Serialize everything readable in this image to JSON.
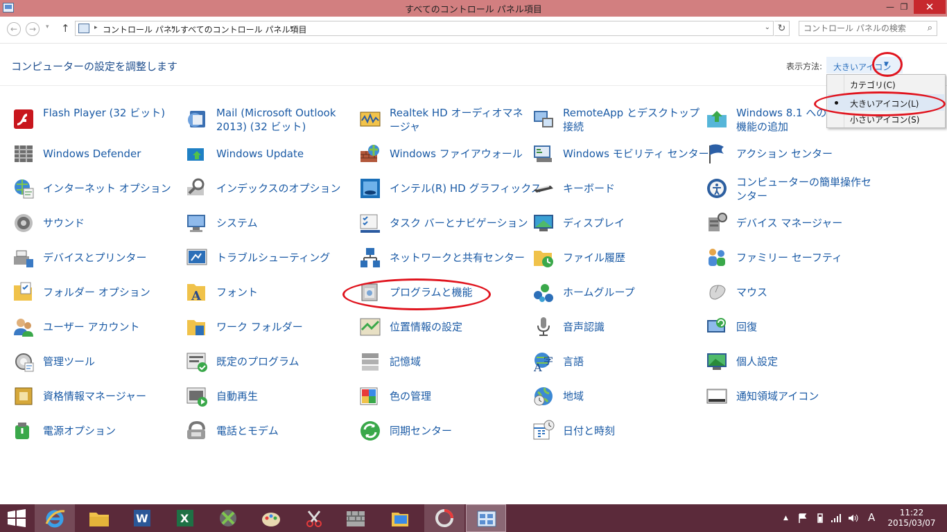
{
  "window": {
    "title": "すべてのコントロール パネル項目",
    "min_glyph": "—",
    "max_glyph": "❐",
    "close_glyph": "✕"
  },
  "address": {
    "back_glyph": "←",
    "fwd_glyph": "→",
    "recent_glyph": "▾",
    "up_glyph": "↑",
    "crumb1": "コントロール パネル",
    "crumb2": "すべてのコントロール パネル項目",
    "sep_glyph": "▸",
    "dd_glyph": "⌄",
    "refresh_glyph": "↻",
    "search_placeholder": "コントロール パネルの検索",
    "search_glyph": "⌕"
  },
  "header": {
    "title": "コンピューターの設定を調整します",
    "viewby_label": "表示方法:",
    "viewby_value": "大きいアイコン",
    "viewby_arrow": "▼"
  },
  "dropdown": {
    "options": [
      {
        "label": "カテゴリ(C)",
        "selected": false
      },
      {
        "label": "大きいアイコン(L)",
        "selected": true
      },
      {
        "label": "小さいアイコン(S)",
        "selected": false
      }
    ]
  },
  "items": [
    {
      "label": "Flash Player (32 ビット)",
      "icon": "flash-icon"
    },
    {
      "label": "Mail (Microsoft Outlook 2013) (32 ビット)",
      "icon": "mail-icon"
    },
    {
      "label": "Realtek HD オーディオマネージャ",
      "icon": "realtek-icon"
    },
    {
      "label": "RemoteApp とデスクトップ接続",
      "icon": "remoteapp-icon"
    },
    {
      "label": "Windows 8.1 への機能の追加",
      "icon": "add-features-icon"
    },
    {
      "label": "Windows Defender",
      "icon": "defender-icon"
    },
    {
      "label": "Windows Update",
      "icon": "windows-update-icon"
    },
    {
      "label": "Windows ファイアウォール",
      "icon": "firewall-icon"
    },
    {
      "label": "Windows モビリティ センター",
      "icon": "mobility-icon"
    },
    {
      "label": "アクション センター",
      "icon": "action-center-icon"
    },
    {
      "label": "インターネット オプション",
      "icon": "internet-options-icon"
    },
    {
      "label": "インデックスのオプション",
      "icon": "indexing-icon"
    },
    {
      "label": "インテル(R) HD グラフィックス",
      "icon": "intel-graphics-icon"
    },
    {
      "label": "キーボード",
      "icon": "keyboard-icon"
    },
    {
      "label": "コンピューターの簡単操作センター",
      "icon": "ease-of-access-icon"
    },
    {
      "label": "サウンド",
      "icon": "sound-icon"
    },
    {
      "label": "システム",
      "icon": "system-icon"
    },
    {
      "label": "タスク バーとナビゲーション",
      "icon": "taskbar-icon"
    },
    {
      "label": "ディスプレイ",
      "icon": "display-icon"
    },
    {
      "label": "デバイス マネージャー",
      "icon": "device-manager-icon"
    },
    {
      "label": "デバイスとプリンター",
      "icon": "devices-printers-icon"
    },
    {
      "label": "トラブルシューティング",
      "icon": "troubleshooting-icon"
    },
    {
      "label": "ネットワークと共有センター",
      "icon": "network-icon"
    },
    {
      "label": "ファイル履歴",
      "icon": "file-history-icon"
    },
    {
      "label": "ファミリー セーフティ",
      "icon": "family-safety-icon"
    },
    {
      "label": "フォルダー オプション",
      "icon": "folder-options-icon"
    },
    {
      "label": "フォント",
      "icon": "fonts-icon"
    },
    {
      "label": "プログラムと機能",
      "icon": "programs-features-icon"
    },
    {
      "label": "ホームグループ",
      "icon": "homegroup-icon"
    },
    {
      "label": "マウス",
      "icon": "mouse-icon"
    },
    {
      "label": "ユーザー アカウント",
      "icon": "user-accounts-icon"
    },
    {
      "label": "ワーク フォルダー",
      "icon": "work-folders-icon"
    },
    {
      "label": "位置情報の設定",
      "icon": "location-icon"
    },
    {
      "label": "音声認識",
      "icon": "speech-icon"
    },
    {
      "label": "回復",
      "icon": "recovery-icon"
    },
    {
      "label": "管理ツール",
      "icon": "admin-tools-icon"
    },
    {
      "label": "既定のプログラム",
      "icon": "default-programs-icon"
    },
    {
      "label": "記憶域",
      "icon": "storage-icon"
    },
    {
      "label": "言語",
      "icon": "language-icon"
    },
    {
      "label": "個人設定",
      "icon": "personalization-icon"
    },
    {
      "label": "資格情報マネージャー",
      "icon": "credential-manager-icon"
    },
    {
      "label": "自動再生",
      "icon": "autoplay-icon"
    },
    {
      "label": "色の管理",
      "icon": "color-management-icon"
    },
    {
      "label": "地域",
      "icon": "region-icon"
    },
    {
      "label": "通知領域アイコン",
      "icon": "notification-icons-icon"
    },
    {
      "label": "電源オプション",
      "icon": "power-options-icon"
    },
    {
      "label": "電話とモデム",
      "icon": "phone-modem-icon"
    },
    {
      "label": "同期センター",
      "icon": "sync-center-icon"
    },
    {
      "label": "日付と時刻",
      "icon": "date-time-icon"
    }
  ],
  "taskbar": {
    "apps": [
      "start-icon",
      "ie-icon",
      "explorer-icon",
      "word-icon",
      "excel-icon",
      "xbox-icon",
      "paint-icon",
      "snipping-icon",
      "wall-icon",
      "photos-icon",
      "power-app-icon",
      "control-panel-icon"
    ],
    "tray_up": "▲",
    "tray_ime": "A",
    "time": "11:22",
    "date": "2015/03/07"
  },
  "colors": {
    "titlebar": "#d27f80",
    "taskbar": "#5b2a3a",
    "link": "#1a5aa5",
    "annotation": "#e0141e"
  }
}
